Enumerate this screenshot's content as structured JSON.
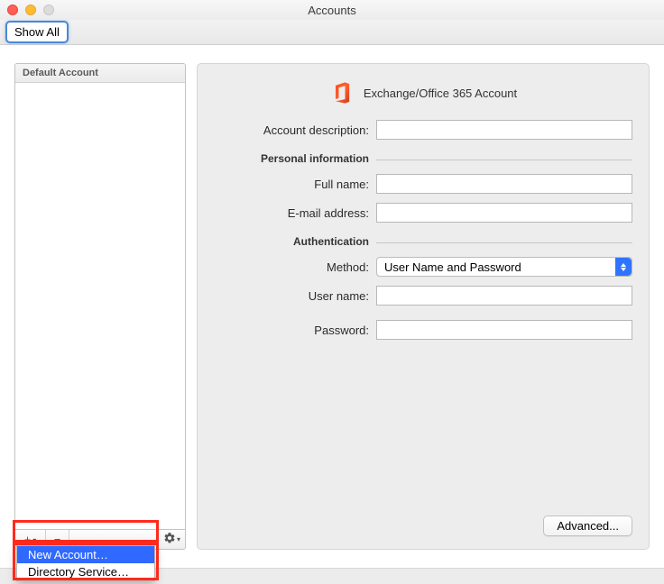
{
  "window": {
    "title": "Accounts"
  },
  "toolbar": {
    "show_all": "Show All"
  },
  "sidebar": {
    "header": "Default Account",
    "footer": {
      "plus_label": "+",
      "minus_label": "−",
      "gear_label": "⚙"
    },
    "plus_menu": [
      {
        "label": "New Account…",
        "selected": true
      },
      {
        "label": "Directory Service…",
        "selected": false
      }
    ]
  },
  "detail": {
    "account_type": "Exchange/Office 365 Account",
    "icon_name": "office365-icon",
    "labels": {
      "description": "Account description:",
      "personal_info": "Personal information",
      "full_name": "Full name:",
      "email": "E-mail address:",
      "authentication": "Authentication",
      "method": "Method:",
      "user_name": "User name:",
      "password": "Password:"
    },
    "values": {
      "description": "",
      "full_name": "",
      "email": "",
      "method": "User Name and Password",
      "user_name": "",
      "password": ""
    },
    "advanced": "Advanced..."
  }
}
